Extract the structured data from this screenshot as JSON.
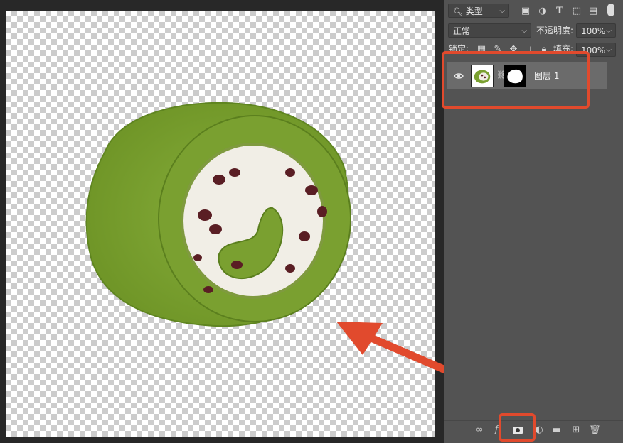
{
  "layers_panel": {
    "filter_kind": "类型",
    "blend_mode": "正常",
    "opacity_label": "不透明度:",
    "opacity_value": "100%",
    "lock_label": "锁定:",
    "fill_label": "填充:",
    "fill_value": "100%",
    "layers": [
      {
        "name": "图层 1",
        "visible": true,
        "has_mask": true
      }
    ],
    "bottom_icons": [
      "link-layers-icon",
      "fx-icon",
      "add-mask-icon",
      "adjustment-icon",
      "group-folder-icon",
      "new-layer-icon",
      "trash-icon"
    ]
  },
  "annotations": {
    "highlight_color": "#e14a2d",
    "arrow_color": "#e14a2d"
  }
}
